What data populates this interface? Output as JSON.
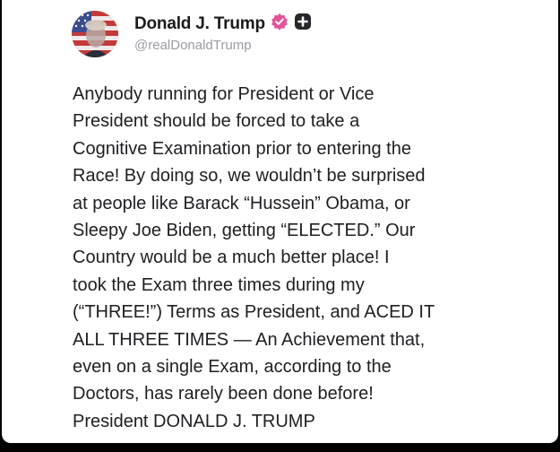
{
  "post": {
    "author": {
      "display_name": "Donald J. Trump",
      "handle": "@realDonaldTrump",
      "avatar_icon": "profile-photo-flag",
      "verified_icon": "verified-badge-icon",
      "action_icon": "plus-icon"
    },
    "body_lines": [
      "Anybody running for President or Vice",
      "President should be forced to take a",
      "Cognitive Examination prior to entering the",
      "Race! By doing so, we wouldn’t be surprised",
      "at people like Barack “Hussein” Obama, or",
      "Sleepy Joe Biden, getting “ELECTED.” Our",
      "Country would be a much better place! I",
      "took the Exam three times during my",
      "(“THREE!”) Terms as President, and ACED IT",
      "ALL THREE TIMES — An Achievement that,",
      "even on a single Exam, according to the",
      "Doctors, has rarely been done before!",
      "President DONALD J. TRUMP"
    ]
  },
  "colors": {
    "background": "#000000",
    "card": "#ffffff",
    "text": "#202024",
    "handle": "#9a9aa2",
    "verified": "#e0549a"
  }
}
